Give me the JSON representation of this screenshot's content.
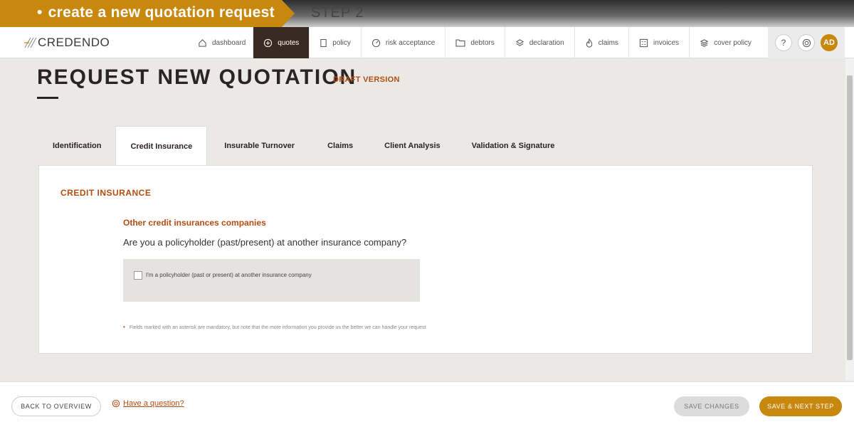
{
  "banner": {
    "task": "create a new quotation request",
    "step": "STEP 2"
  },
  "brand": {
    "name": "CREDENDO"
  },
  "nav": {
    "items": [
      {
        "label": "dashboard",
        "icon": "home-icon"
      },
      {
        "label": "quotes",
        "icon": "plus-circle-icon",
        "active": true
      },
      {
        "label": "policy",
        "icon": "document-icon"
      },
      {
        "label": "risk acceptance",
        "icon": "gauge-icon"
      },
      {
        "label": "debtors",
        "icon": "folder-icon"
      },
      {
        "label": "declaration",
        "icon": "layers-icon"
      },
      {
        "label": "claims",
        "icon": "flame-icon"
      },
      {
        "label": "invoices",
        "icon": "invoice-icon"
      },
      {
        "label": "cover policy",
        "icon": "stack-icon"
      }
    ],
    "help": "?",
    "avatar": "AD"
  },
  "page": {
    "title": "REQUEST NEW QUOTATION",
    "badge": "DRAFT VERSION"
  },
  "tabs": [
    {
      "label": "Identification"
    },
    {
      "label": "Credit Insurance",
      "active": true
    },
    {
      "label": "Insurable Turnover"
    },
    {
      "label": "Claims"
    },
    {
      "label": "Client Analysis"
    },
    {
      "label": "Validation & Signature"
    }
  ],
  "section": {
    "title": "CREDIT INSURANCE",
    "subheading": "Other credit insurances companies",
    "question": "Are you a policyholder (past/present) at another insurance company?",
    "checkbox_label": "I'm a policyholder (past or present) at another insurance company",
    "checkbox_checked": false,
    "footnote": "Fields marked with an asterisk are mandatory, but note that the more information you provide us the better we can handle your request"
  },
  "footer": {
    "back": "BACK TO OVERVIEW",
    "help_link": "Have a question?",
    "save": "SAVE CHANGES",
    "next": "SAVE & NEXT STEP"
  },
  "colors": {
    "accent": "#c8870d",
    "brand_text": "#b34d10",
    "nav_active": "#3a2a24"
  }
}
